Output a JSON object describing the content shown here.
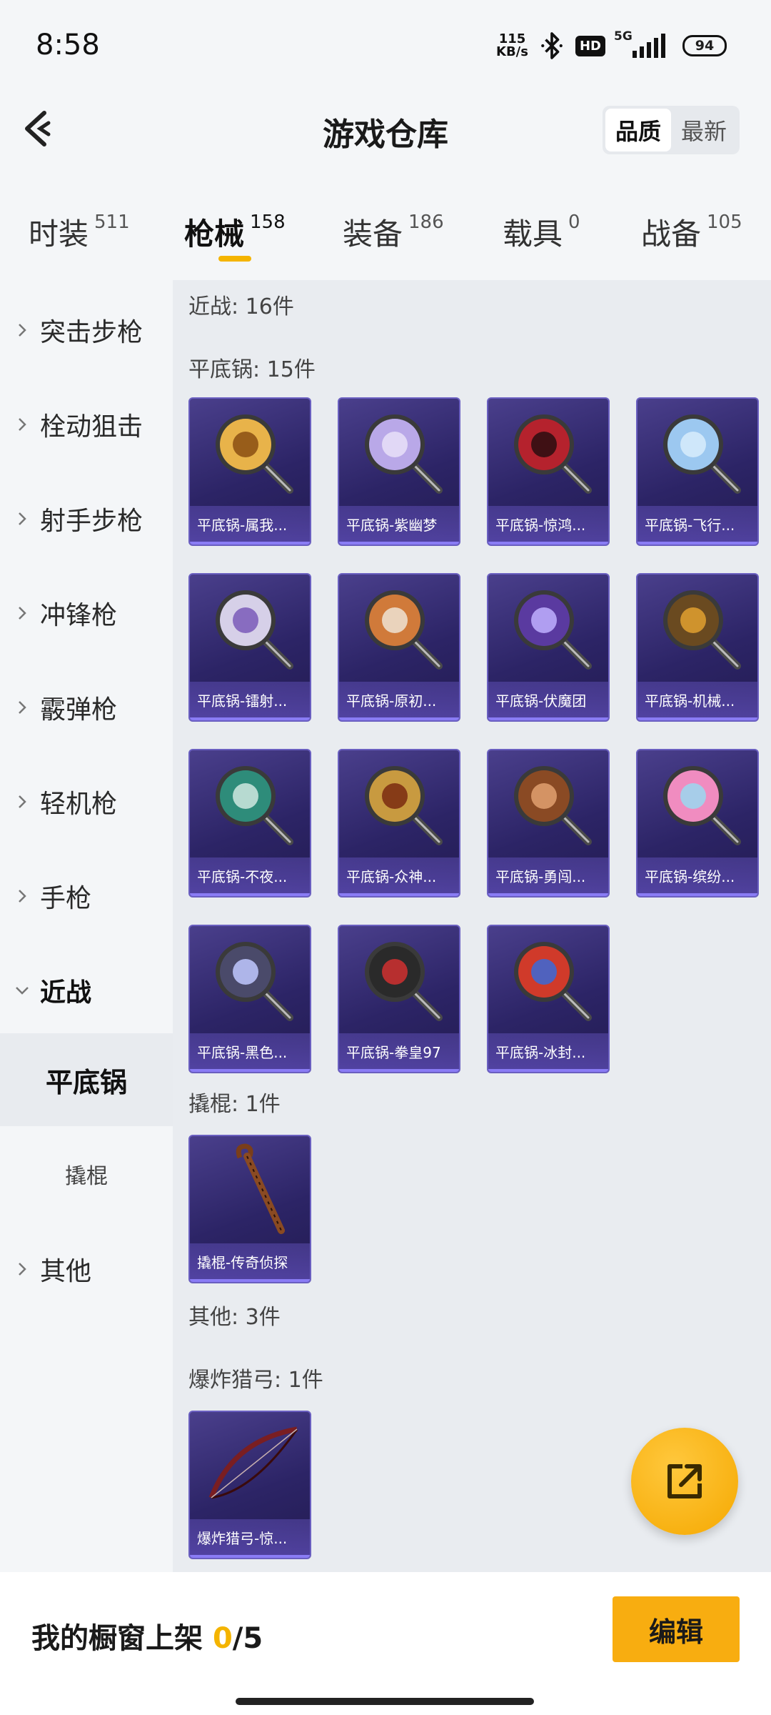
{
  "status": {
    "time": "8:58",
    "net_speed_top": "115",
    "net_speed_unit": "KB/s",
    "hd": "HD",
    "network": "5G",
    "battery": "94"
  },
  "header": {
    "title": "游戏仓库",
    "sort_quality": "品质",
    "sort_latest": "最新"
  },
  "tabs": [
    {
      "label": "时装",
      "count": "511"
    },
    {
      "label": "枪械",
      "count": "158"
    },
    {
      "label": "装备",
      "count": "186"
    },
    {
      "label": "载具",
      "count": "0"
    },
    {
      "label": "战备",
      "count": "105"
    }
  ],
  "sidebar": {
    "items": [
      "突击步枪",
      "栓动狙击",
      "射手步枪",
      "冲锋枪",
      "霰弹枪",
      "轻机枪",
      "手枪",
      "近战"
    ],
    "sub_active": "平底锅",
    "sub_other": "撬棍",
    "last": "其他"
  },
  "sections": {
    "melee": "近战: 16件",
    "pan": "平底锅: 15件",
    "crowbar": "撬棍: 1件",
    "other": "其他: 3件",
    "bow": "爆炸猎弓: 1件"
  },
  "pan_items": [
    "平底锅-属我...",
    "平底锅-紫幽梦",
    "平底锅-惊鸿...",
    "平底锅-飞行...",
    "平底锅-镭射...",
    "平底锅-原初...",
    "平底锅-伏魔团",
    "平底锅-机械...",
    "平底锅-不夜...",
    "平底锅-众神...",
    "平底锅-勇闯...",
    "平底锅-缤纷...",
    "平底锅-黑色...",
    "平底锅-拳皇97",
    "平底锅-冰封..."
  ],
  "crowbar_items": [
    "撬棍-传奇侦探"
  ],
  "bow_items": [
    "爆炸猎弓-惊..."
  ],
  "bottom": {
    "showcase_label": "我的橱窗上架",
    "showcase_current": "0",
    "showcase_total": "/5",
    "edit_label": "编辑"
  },
  "colors": {
    "accent": "#f4b400",
    "card_bg": "#2c2466",
    "card_border": "#6a5fc0"
  }
}
